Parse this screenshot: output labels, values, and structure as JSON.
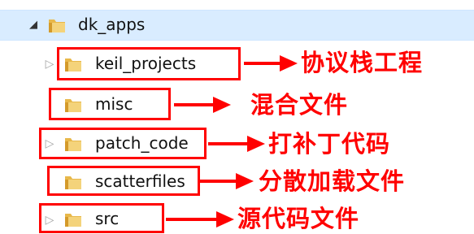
{
  "tree": {
    "root": {
      "label": "dk_apps",
      "expanded": true
    },
    "items": [
      {
        "label": "keil_projects",
        "has_children": true,
        "note": "协议栈工程"
      },
      {
        "label": "misc",
        "has_children": false,
        "note": "混合文件"
      },
      {
        "label": "patch_code",
        "has_children": true,
        "note": "打补丁代码"
      },
      {
        "label": "scatterfiles",
        "has_children": false,
        "note": "分散加载文件"
      },
      {
        "label": "src",
        "has_children": true,
        "note": "源代码文件"
      }
    ]
  },
  "colors": {
    "selection_bg": "#d9ecff",
    "annotation": "#ff0000",
    "folder": "#e8b84a"
  },
  "icons": {
    "expander_open": "triangle-down-icon",
    "expander_closed": "triangle-right-icon",
    "folder": "folder-icon",
    "arrow": "right-arrow-icon"
  }
}
